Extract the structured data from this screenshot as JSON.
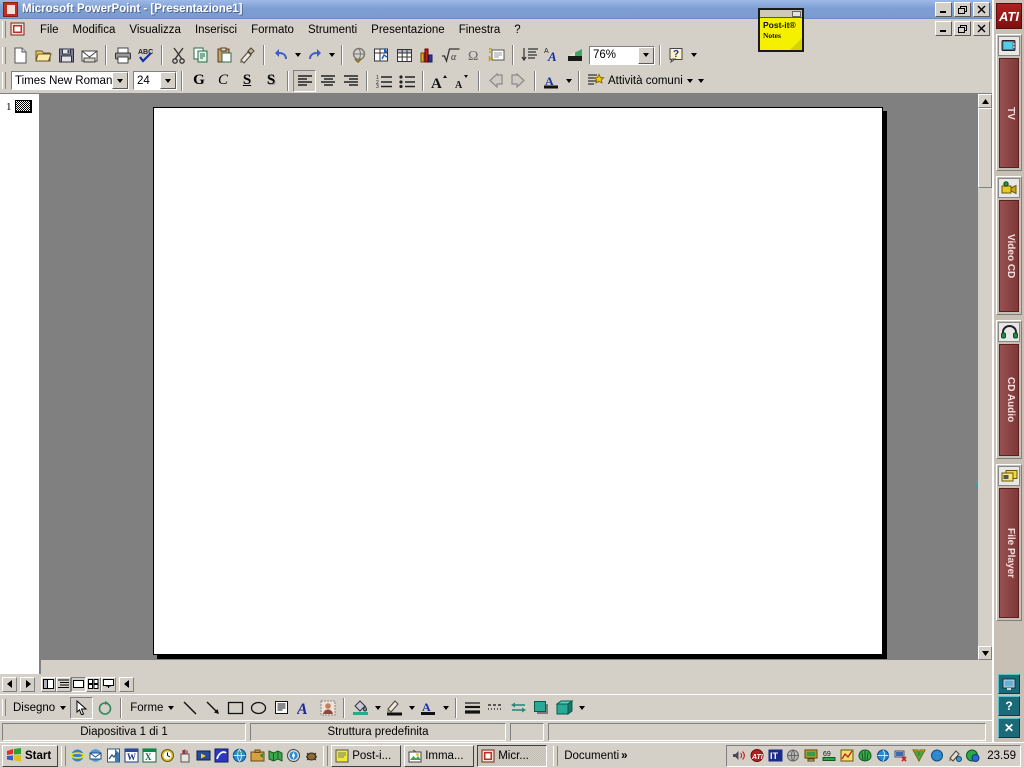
{
  "window": {
    "title": "Microsoft PowerPoint - [Presentazione1]",
    "app_icon": "powerpoint-icon",
    "controls": {
      "minimize": "_",
      "restore": "❐",
      "close": "✕"
    },
    "mdi_controls": {
      "minimize": "_",
      "restore": "❐",
      "close": "✕"
    }
  },
  "menubar": {
    "doc_icon": "document-icon",
    "items": [
      {
        "label": "File",
        "accel": "F"
      },
      {
        "label": "Modifica",
        "accel": "M"
      },
      {
        "label": "Visualizza",
        "accel": "V"
      },
      {
        "label": "Inserisci",
        "accel": "I"
      },
      {
        "label": "Formato",
        "accel": "r"
      },
      {
        "label": "Strumenti",
        "accel": "S"
      },
      {
        "label": "Presentazione",
        "accel": "P"
      },
      {
        "label": "Finestra",
        "accel": "n"
      },
      {
        "label": "?",
        "accel": ""
      }
    ]
  },
  "toolbar_standard": {
    "buttons": [
      {
        "name": "new-file-icon",
        "tip": "Nuovo"
      },
      {
        "name": "open-folder-icon",
        "tip": "Apri"
      },
      {
        "name": "save-disk-icon",
        "tip": "Salva"
      },
      {
        "name": "mail-icon",
        "tip": "Posta elettronica"
      },
      {
        "name": "print-icon",
        "tip": "Stampa"
      },
      {
        "name": "spellcheck-icon",
        "tip": "Controllo ortografia"
      },
      {
        "name": "cut-scissors-icon",
        "tip": "Taglia"
      },
      {
        "name": "copy-icon",
        "tip": "Copia"
      },
      {
        "name": "paste-clipboard-icon",
        "tip": "Incolla"
      },
      {
        "name": "format-painter-icon",
        "tip": "Copia formato"
      },
      {
        "name": "undo-icon",
        "tip": "Annulla"
      },
      {
        "name": "redo-icon",
        "tip": "Ripristina"
      },
      {
        "name": "hyperlink-icon",
        "tip": "Inserisci collegamento ipertestuale"
      },
      {
        "name": "insert-chart-excel-icon",
        "tip": "Inserisci foglio di calcolo"
      },
      {
        "name": "insert-table-icon",
        "tip": "Inserisci tabella"
      },
      {
        "name": "insert-chart-icon",
        "tip": "Inserisci grafico"
      },
      {
        "name": "formula-icon",
        "tip": "Equazione"
      },
      {
        "name": "symbol-omega-icon",
        "tip": "Simbolo"
      },
      {
        "name": "new-slide-icon",
        "tip": "Nuova diapositiva"
      },
      {
        "name": "expand-all-icon",
        "tip": "Espandi tutto"
      },
      {
        "name": "show-formatting-icon",
        "tip": "Mostra formattazione"
      },
      {
        "name": "grayscale-preview-icon",
        "tip": "Anteprima scala di grigi"
      },
      {
        "name": "help-icon",
        "tip": "Guida"
      }
    ],
    "zoom_value": "76%"
  },
  "toolbar_formatting": {
    "font_name": "Times New Roman",
    "font_size": "24",
    "bold_label": "G",
    "italic_label": "C",
    "underline_label": "S",
    "shadow_label": "S",
    "buttons": [
      {
        "name": "align-left-icon"
      },
      {
        "name": "align-center-icon"
      },
      {
        "name": "align-right-icon"
      },
      {
        "name": "numbered-list-icon"
      },
      {
        "name": "bulleted-list-icon"
      },
      {
        "name": "increase-font-size-icon"
      },
      {
        "name": "decrease-font-size-icon"
      },
      {
        "name": "promote-icon"
      },
      {
        "name": "demote-icon"
      },
      {
        "name": "font-color-icon"
      },
      {
        "name": "common-tasks-icon"
      }
    ],
    "common_tasks_label": "Attività comuni"
  },
  "outline": {
    "slide_number": "1",
    "thumb": "slide-thumbnail-icon"
  },
  "slide": {
    "background": "#ffffff",
    "globe_decoration": "globe-icon"
  },
  "view_bar": {
    "buttons": [
      {
        "name": "scroll-left-icon"
      },
      {
        "name": "scroll-right-icon"
      },
      {
        "name": "view-normal-icon"
      },
      {
        "name": "view-outline-icon"
      },
      {
        "name": "view-slide-icon",
        "active": true
      },
      {
        "name": "view-slide-sorter-icon"
      },
      {
        "name": "view-slide-show-icon"
      }
    ]
  },
  "drawing_toolbar": {
    "draw_menu_label": "Disegno",
    "shapes_menu_label": "Forme",
    "buttons": [
      {
        "name": "select-arrow-icon"
      },
      {
        "name": "free-rotate-icon"
      },
      {
        "name": "line-icon"
      },
      {
        "name": "arrow-icon"
      },
      {
        "name": "rectangle-icon"
      },
      {
        "name": "ellipse-icon"
      },
      {
        "name": "text-box-icon"
      },
      {
        "name": "wordart-icon"
      },
      {
        "name": "insert-clipart-icon"
      },
      {
        "name": "fill-color-icon"
      },
      {
        "name": "line-color-icon"
      },
      {
        "name": "font-color-icon"
      },
      {
        "name": "line-style-icon"
      },
      {
        "name": "dash-style-icon"
      },
      {
        "name": "arrow-style-icon"
      },
      {
        "name": "shadow-icon"
      },
      {
        "name": "3d-icon"
      }
    ]
  },
  "statusbar": {
    "slide_info": "Diapositiva 1 di 1",
    "design_info": "Struttura predefinita",
    "extra": ""
  },
  "media_sidebar": {
    "logo_label": "ATI",
    "items": [
      {
        "label": "TV",
        "icon": "tv-icon"
      },
      {
        "label": "Video CD",
        "icon": "video-camera-icon"
      },
      {
        "label": "CD Audio",
        "icon": "headphones-icon"
      },
      {
        "label": "File Player",
        "icon": "file-player-icon"
      }
    ],
    "bottom_buttons": [
      {
        "name": "monitor-icon",
        "glyph": "▣"
      },
      {
        "name": "help-icon",
        "glyph": "?"
      },
      {
        "name": "close-icon",
        "glyph": "✕"
      }
    ]
  },
  "postit": {
    "title_line1": "Post-it®",
    "title_line2": "Notes",
    "minimize": "_"
  },
  "taskbar": {
    "start_label": "Start",
    "start_icon": "windows-flag-icon",
    "quick_launch": [
      {
        "name": "internet-explorer-icon"
      },
      {
        "name": "outlook-express-icon"
      },
      {
        "name": "frontpage-icon"
      },
      {
        "name": "word-icon"
      },
      {
        "name": "excel-icon"
      },
      {
        "name": "clock-icon"
      },
      {
        "name": "paint-icon"
      },
      {
        "name": "media-icon"
      },
      {
        "name": "netscape-icon"
      },
      {
        "name": "globe-browser-icon"
      },
      {
        "name": "briefcase-icon"
      },
      {
        "name": "maps-icon"
      },
      {
        "name": "compass-icon"
      },
      {
        "name": "bug-icon"
      }
    ],
    "tasks": [
      {
        "label": "Post-i...",
        "icon": "postit-icon",
        "active": false
      },
      {
        "label": "Imma...",
        "icon": "imaging-icon",
        "active": false
      },
      {
        "label": "Micr...",
        "icon": "powerpoint-icon",
        "active": true
      }
    ],
    "toolband_label": "Documenti",
    "toolband_chevron": "»",
    "tray_icons": [
      {
        "name": "volume-icon"
      },
      {
        "name": "ati-icon"
      },
      {
        "name": "keyboard-layout-icon",
        "label": "IT"
      },
      {
        "name": "network-globe-icon"
      },
      {
        "name": "display-icon"
      },
      {
        "name": "temperature-icon",
        "label": "69"
      },
      {
        "name": "graph-icon"
      },
      {
        "name": "shell-icon"
      },
      {
        "name": "internet-icon"
      },
      {
        "name": "network-disconnected-icon"
      },
      {
        "name": "norton-icon"
      },
      {
        "name": "world-icon"
      },
      {
        "name": "paint-tray-icon"
      },
      {
        "name": "color-tray-icon"
      }
    ],
    "clock": "23.59"
  },
  "colors": {
    "title_bar_start": "#9db9e8",
    "title_bar_end": "#7a9bd1",
    "chrome": "#d4d0c8",
    "workspace": "#808080",
    "slide": "#ffffff",
    "sidebar": "#c8c0b4",
    "sidebar_label": "#8d4444",
    "postit": "#f5f000"
  }
}
